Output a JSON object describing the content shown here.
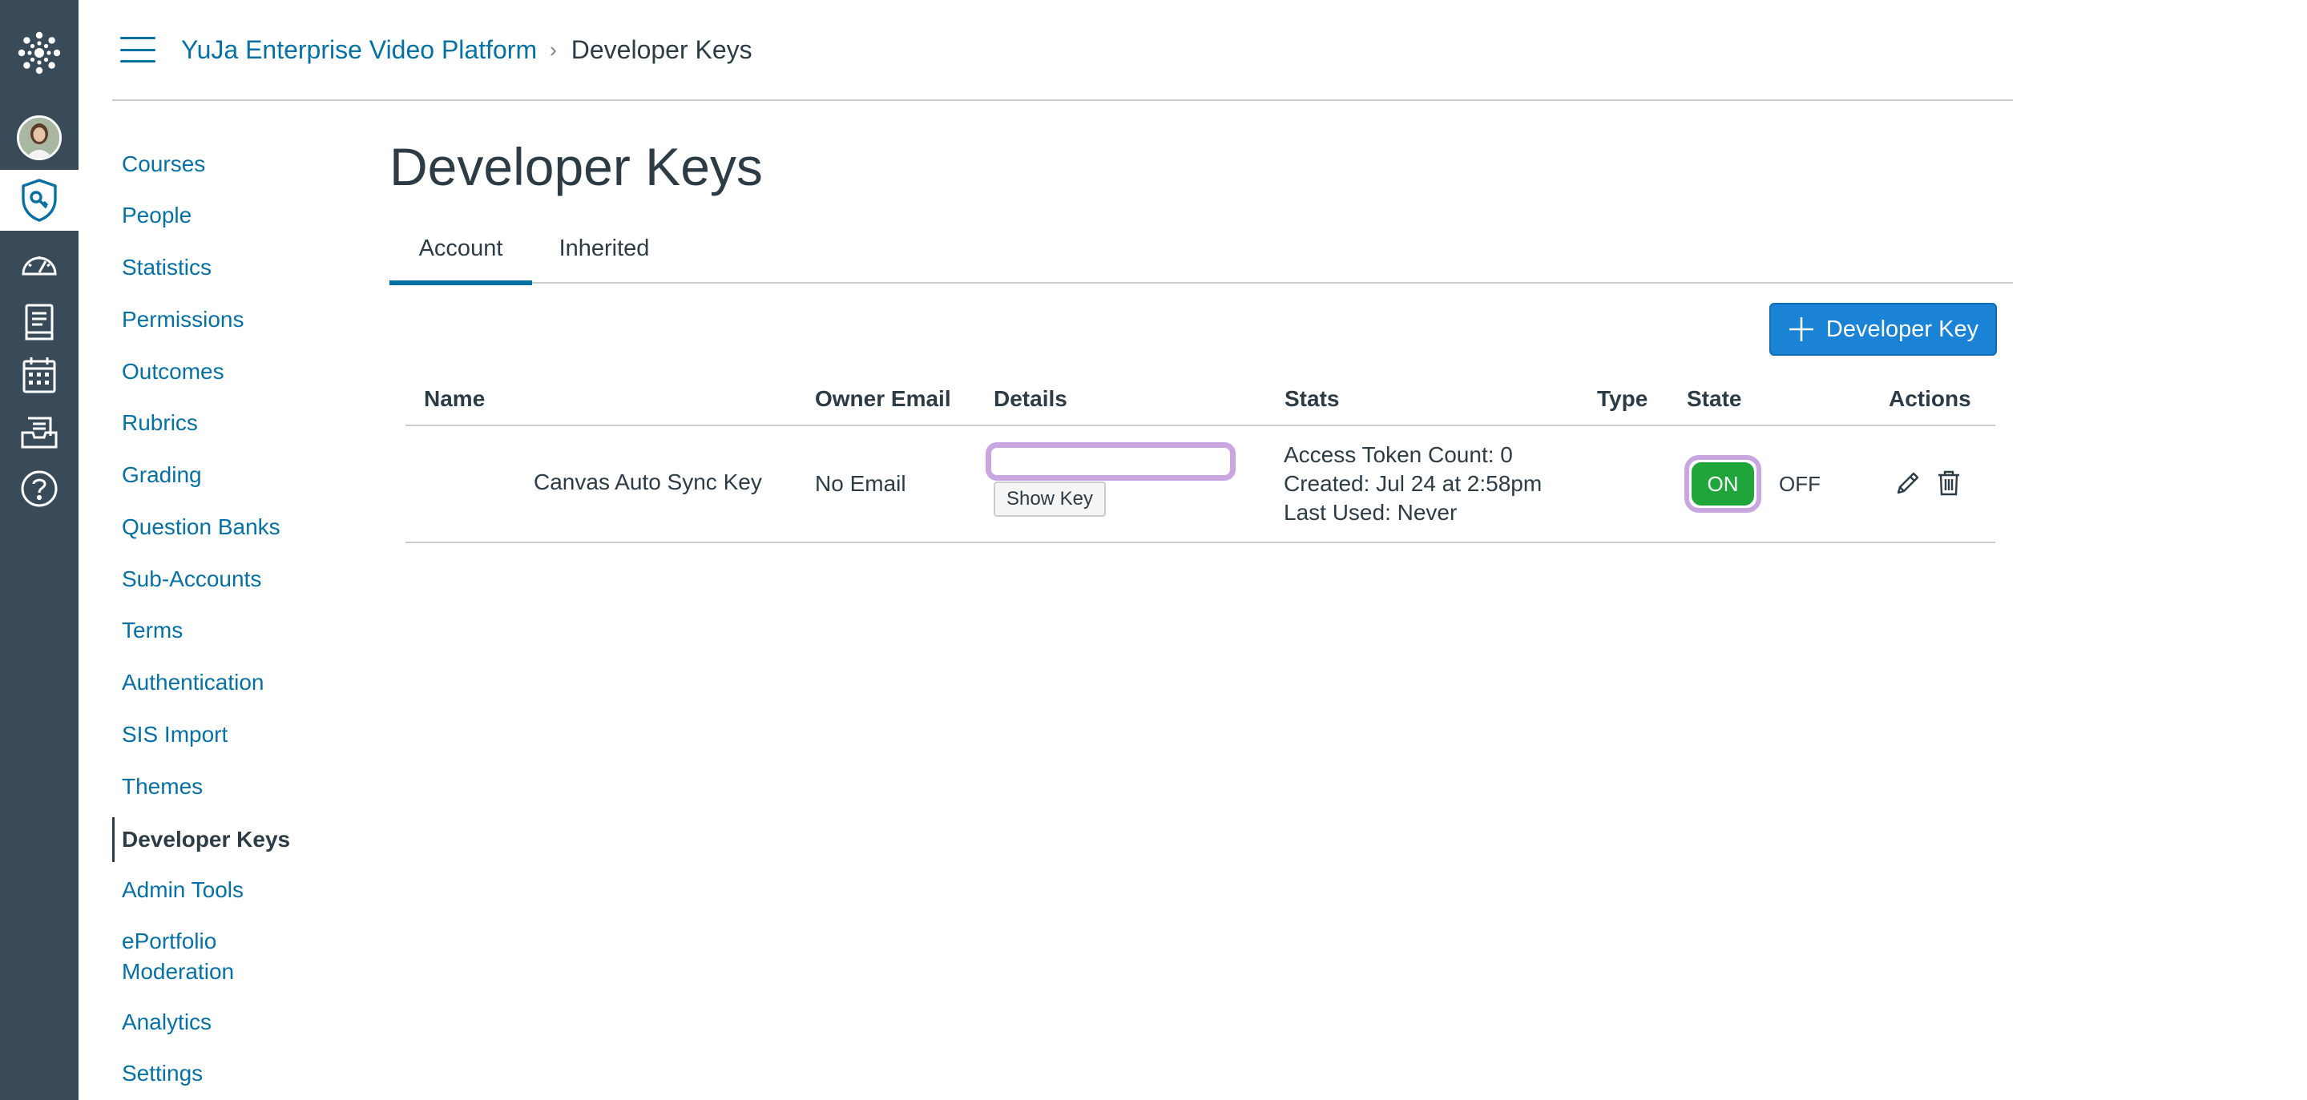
{
  "header": {
    "breadcrumb_root": "YuJa Enterprise Video Platform",
    "breadcrumb_separator": "›",
    "breadcrumb_current": "Developer Keys"
  },
  "global_nav": {
    "icons": [
      "canvas-logo-icon",
      "avatar",
      "admin-shield-icon",
      "dashboard-icon",
      "courses-book-icon",
      "calendar-icon",
      "inbox-icon",
      "help-icon"
    ]
  },
  "subnav": {
    "items": [
      {
        "label": "Courses"
      },
      {
        "label": "People"
      },
      {
        "label": "Statistics"
      },
      {
        "label": "Permissions"
      },
      {
        "label": "Outcomes"
      },
      {
        "label": "Rubrics"
      },
      {
        "label": "Grading"
      },
      {
        "label": "Question Banks"
      },
      {
        "label": "Sub-Accounts"
      },
      {
        "label": "Terms"
      },
      {
        "label": "Authentication"
      },
      {
        "label": "SIS Import"
      },
      {
        "label": "Themes"
      },
      {
        "label": "Developer Keys"
      },
      {
        "label": "Admin Tools"
      },
      {
        "label": "ePortfolio\nModeration"
      },
      {
        "label": "Analytics"
      },
      {
        "label": "Settings"
      }
    ],
    "active": "Developer Keys"
  },
  "main": {
    "title": "Developer Keys",
    "tabs": [
      {
        "label": "Account",
        "selected": true
      },
      {
        "label": "Inherited",
        "selected": false
      }
    ],
    "add_button_label": "Developer Key"
  },
  "table": {
    "headers": {
      "name": "Name",
      "owner_email": "Owner Email",
      "details": "Details",
      "stats": "Stats",
      "type": "Type",
      "state": "State",
      "actions": "Actions"
    },
    "rows": [
      {
        "name": "Canvas Auto Sync Key",
        "owner_email": "No Email",
        "details_key_value": "",
        "show_key_label": "Show Key",
        "stats": {
          "access_token_count": "Access Token Count: 0",
          "created": "Created: Jul 24 at 2:58pm",
          "last_used": "Last Used: Never"
        },
        "type": "",
        "state_on_label": "ON",
        "state_off_label": "OFF",
        "state": "on"
      }
    ]
  },
  "colors": {
    "nav_bg": "#394b58",
    "link": "#0770a3",
    "primary_button": "#1a83d6",
    "toggle_on": "#1fa53a",
    "highlight_outline": "#c9a6e0"
  }
}
